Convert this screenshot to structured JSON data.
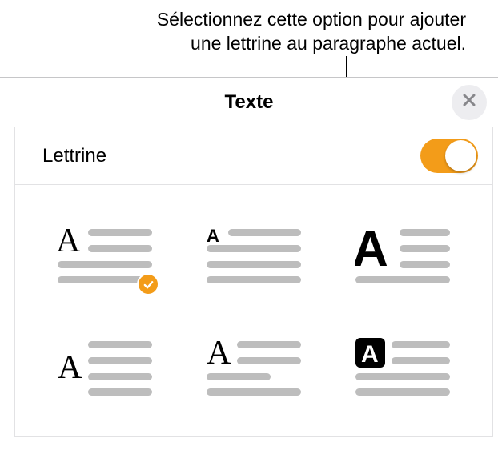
{
  "callout": {
    "line1": "Sélectionnez cette option pour ajouter",
    "line2": "une lettrine au paragraphe actuel."
  },
  "panel": {
    "title": "Texte",
    "close_icon": "close"
  },
  "toggle": {
    "label": "Lettrine",
    "state": "on"
  },
  "styles": {
    "options": [
      {
        "id": "drop-two-lines",
        "selected": true
      },
      {
        "id": "drop-small-letter",
        "selected": false
      },
      {
        "id": "drop-large-bold",
        "selected": false
      },
      {
        "id": "raised-indent",
        "selected": false
      },
      {
        "id": "raised-aligned",
        "selected": false
      },
      {
        "id": "boxed-reversed",
        "selected": false
      }
    ]
  },
  "colors": {
    "accent": "#f39c19",
    "line": "#bdbdbd"
  }
}
